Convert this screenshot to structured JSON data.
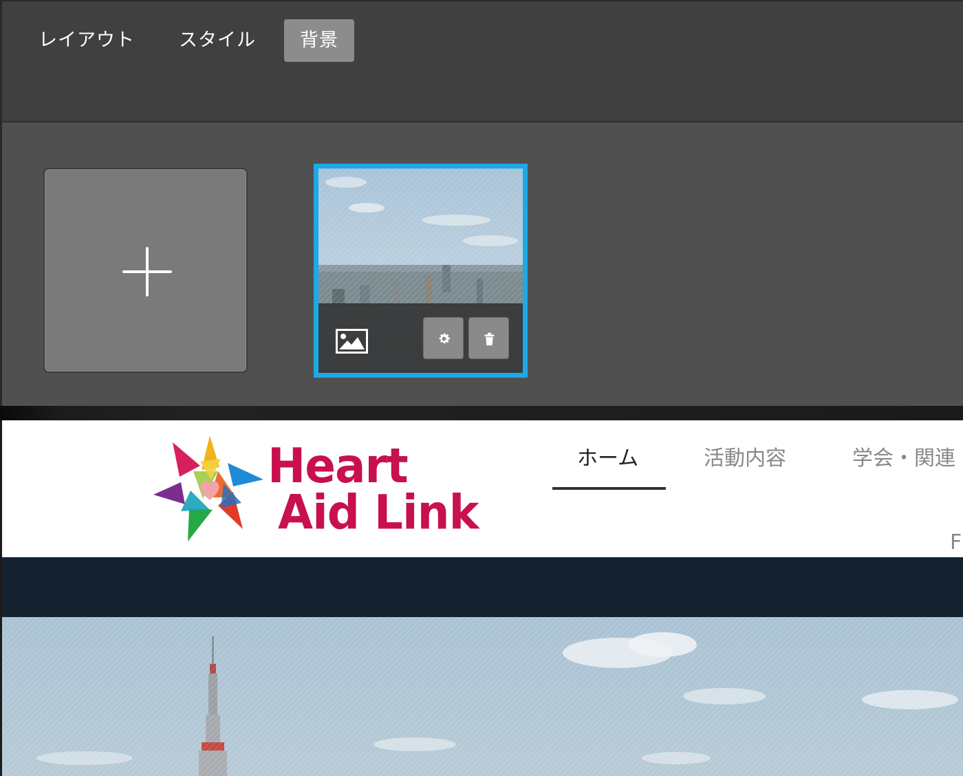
{
  "editor": {
    "tabs": [
      {
        "label": "レイアウト",
        "active": false
      },
      {
        "label": "スタイル",
        "active": false
      },
      {
        "label": "背景",
        "active": true
      }
    ],
    "tiles": {
      "add": {
        "icon": "plus-icon"
      },
      "background": {
        "selected": true,
        "type_icon": "image-icon",
        "actions": [
          {
            "icon": "gear-icon"
          },
          {
            "icon": "trash-icon"
          }
        ]
      }
    },
    "colors": {
      "selection_border": "#1ea9e6",
      "active_tab": "#8c8c8c"
    }
  },
  "site": {
    "logo": {
      "line1": "Heart",
      "line2": "Aid Link",
      "color": "#c8104f"
    },
    "nav": [
      {
        "label": "ホーム",
        "active": true
      },
      {
        "label": "活動内容",
        "active": false
      },
      {
        "label": "学会・関連",
        "active": false
      },
      {
        "label": "F",
        "active": false
      }
    ],
    "band_color": "#142230"
  }
}
